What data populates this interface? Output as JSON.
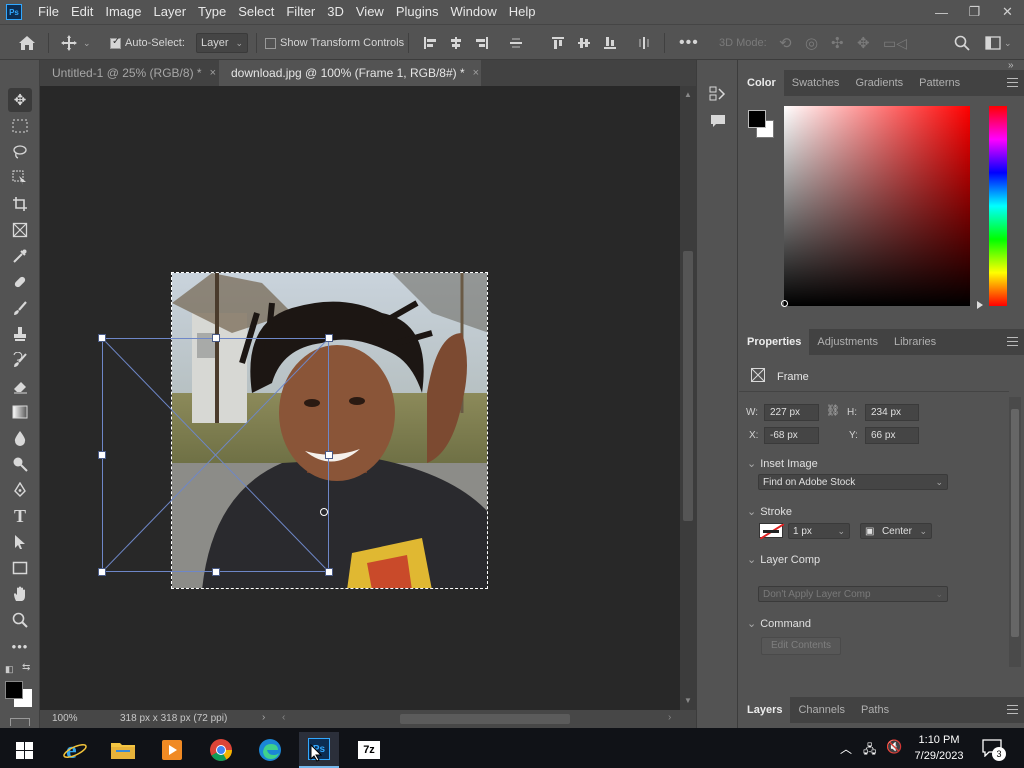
{
  "menu": [
    "File",
    "Edit",
    "Image",
    "Layer",
    "Type",
    "Select",
    "Filter",
    "3D",
    "View",
    "Plugins",
    "Window",
    "Help"
  ],
  "window_controls": {
    "minimize": "—",
    "restore": "❐",
    "close": "✕"
  },
  "options": {
    "auto_select_label": "Auto-Select:",
    "auto_select_target": "Layer",
    "show_transform_label": "Show Transform Controls",
    "mode_3d_label": "3D Mode:"
  },
  "tabs": [
    {
      "label": "Untitled-1 @ 25% (RGB/8) *",
      "close": "×"
    },
    {
      "label": "download.jpg @ 100% (Frame 1, RGB/8#) *",
      "close": "×"
    }
  ],
  "status": {
    "zoom": "100%",
    "doc_info": "318 px x 318 px (72 ppi)"
  },
  "color_panel": {
    "tabs": [
      "Color",
      "Swatches",
      "Gradients",
      "Patterns"
    ],
    "active": "Color",
    "foreground": "#000000",
    "background": "#ffffff"
  },
  "properties_panel": {
    "tabs": [
      "Properties",
      "Adjustments",
      "Libraries"
    ],
    "active": "Properties",
    "object_type": "Frame",
    "w_label": "W:",
    "w_value": "227 px",
    "h_label": "H:",
    "h_value": "234 px",
    "x_label": "X:",
    "x_value": "-68 px",
    "y_label": "Y:",
    "y_value": "66 px",
    "inset_image_label": "Inset Image",
    "inset_image_option": "Find on Adobe Stock",
    "stroke_label": "Stroke",
    "stroke_width": "1 px",
    "stroke_position": "Center",
    "layer_comp_label": "Layer Comp",
    "layer_comp_option": "Don't Apply Layer Comp",
    "command_label": "Command",
    "edit_contents_label": "Edit Contents"
  },
  "layers_panel": {
    "tabs": [
      "Layers",
      "Channels",
      "Paths"
    ],
    "active": "Layers"
  },
  "taskbar": {
    "time": "1:10 PM",
    "date": "7/29/2023",
    "notifications": "3"
  }
}
